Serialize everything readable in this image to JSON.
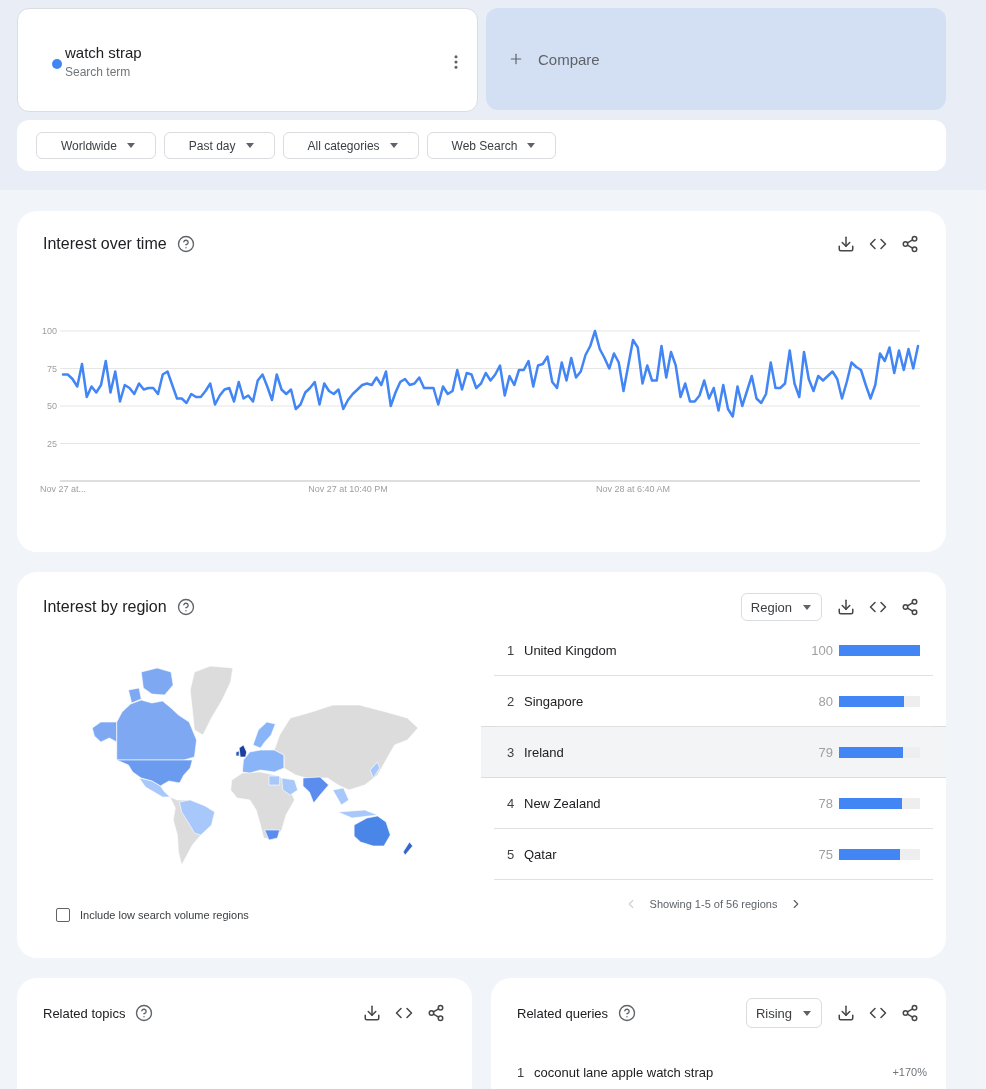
{
  "search": {
    "term": "watch strap",
    "label": "Search term"
  },
  "compare": {
    "label": "Compare"
  },
  "filters": [
    {
      "label": "Worldwide"
    },
    {
      "label": "Past day"
    },
    {
      "label": "All categories"
    },
    {
      "label": "Web Search"
    }
  ],
  "interest_over_time": {
    "title": "Interest over time",
    "chart_data": {
      "type": "line",
      "grid": true,
      "categories": [
        "Nov 27 at...",
        null,
        null,
        null,
        null,
        null,
        null,
        null,
        null,
        null,
        null,
        null,
        null,
        null,
        null,
        null,
        null,
        null,
        null,
        null,
        null,
        null,
        null,
        null,
        null,
        null,
        null,
        null,
        null,
        null,
        null,
        null,
        null,
        null,
        null,
        null,
        null,
        null,
        null,
        null,
        null,
        null,
        null,
        null,
        null,
        null,
        null,
        null,
        null,
        null,
        null,
        null,
        null,
        null,
        null,
        null,
        null,
        null,
        null,
        null,
        "Nov 27 at 10:40 PM",
        null,
        null,
        null,
        null,
        null,
        null,
        null,
        null,
        null,
        null,
        null,
        null,
        null,
        null,
        null,
        null,
        null,
        null,
        null,
        null,
        null,
        null,
        null,
        null,
        null,
        null,
        null,
        null,
        null,
        null,
        null,
        null,
        null,
        null,
        null,
        null,
        null,
        null,
        null,
        null,
        null,
        null,
        null,
        null,
        null,
        null,
        null,
        null,
        null,
        null,
        null,
        null,
        null,
        null,
        null,
        null,
        null,
        null,
        null,
        "Nov 28 at 6:40 AM",
        null,
        null,
        null,
        null,
        null,
        null,
        null,
        null,
        null,
        null,
        null,
        null,
        null,
        null,
        null,
        null,
        null,
        null,
        null,
        null,
        null,
        null,
        null,
        null,
        null,
        null,
        null,
        null,
        null,
        null,
        null,
        null,
        null,
        null,
        null,
        null,
        null,
        null,
        null,
        null,
        null,
        null,
        null,
        null,
        null,
        null,
        null,
        null,
        null,
        null,
        null,
        null,
        null,
        null,
        null,
        null,
        null,
        null,
        null,
        null
      ],
      "ylim": [
        0,
        100
      ],
      "yticks": [
        25,
        50,
        75,
        100
      ],
      "series": [
        {
          "color": "#4285f4",
          "values": [
            71,
            71,
            68,
            63,
            78,
            56,
            63,
            59,
            64,
            80,
            59,
            73,
            53,
            64,
            62,
            58,
            65,
            61,
            62,
            62,
            58,
            71,
            73,
            64,
            55,
            55,
            52,
            58,
            56,
            56,
            60,
            65,
            51,
            57,
            61,
            62,
            53,
            66,
            55,
            57,
            53,
            67,
            71,
            63,
            54,
            71,
            61,
            58,
            61,
            48,
            51,
            59,
            62,
            66,
            51,
            65,
            60,
            58,
            61,
            48,
            54,
            58,
            61,
            64,
            65,
            64,
            69,
            64,
            73,
            50,
            59,
            66,
            68,
            64,
            65,
            69,
            62,
            62,
            62,
            51,
            63,
            58,
            60,
            74,
            61,
            72,
            71,
            62,
            65,
            72,
            67,
            71,
            77,
            57,
            70,
            64,
            74,
            74,
            80,
            63,
            77,
            78,
            83,
            66,
            62,
            79,
            67,
            82,
            69,
            73,
            84,
            90,
            100,
            88,
            82,
            75,
            85,
            79,
            60,
            77,
            94,
            89,
            65,
            77,
            67,
            67,
            90,
            69,
            86,
            77,
            56,
            65,
            53,
            53,
            57,
            67,
            55,
            62,
            47,
            64,
            48,
            43,
            63,
            50,
            60,
            70,
            55,
            52,
            58,
            79,
            62,
            62,
            65,
            87,
            65,
            56,
            86,
            68,
            60,
            70,
            67,
            70,
            73,
            68,
            55,
            66,
            79,
            76,
            74,
            64,
            55,
            64,
            85,
            80,
            89,
            72,
            87,
            74,
            88,
            75,
            90
          ]
        }
      ]
    }
  },
  "interest_by_region": {
    "title": "Interest by region",
    "dropdown": "Region",
    "rows": [
      {
        "rank": "1",
        "name": "United Kingdom",
        "value": "100",
        "level": 1,
        "highlighted": false
      },
      {
        "rank": "2",
        "name": "Singapore",
        "value": "80",
        "level": 0.8,
        "highlighted": false
      },
      {
        "rank": "3",
        "name": "Ireland",
        "value": "79",
        "level": 0.79,
        "highlighted": true
      },
      {
        "rank": "4",
        "name": "New Zealand",
        "value": "78",
        "level": 0.78,
        "highlighted": false
      },
      {
        "rank": "5",
        "name": "Qatar",
        "value": "75",
        "level": 0.75,
        "highlighted": false
      }
    ],
    "low_volume": {
      "label": "Include low search volume regions",
      "checked": false
    },
    "pagination": {
      "text": "Showing 1-5 of 56 regions",
      "prev_disabled": true,
      "next_disabled": false
    }
  },
  "related_topics": {
    "title": "Related topics"
  },
  "related_queries": {
    "title": "Related queries",
    "dropdown": "Rising",
    "rows": [
      {
        "rank": "1",
        "query": "coconut lane apple watch strap",
        "change": "+170%"
      }
    ]
  }
}
